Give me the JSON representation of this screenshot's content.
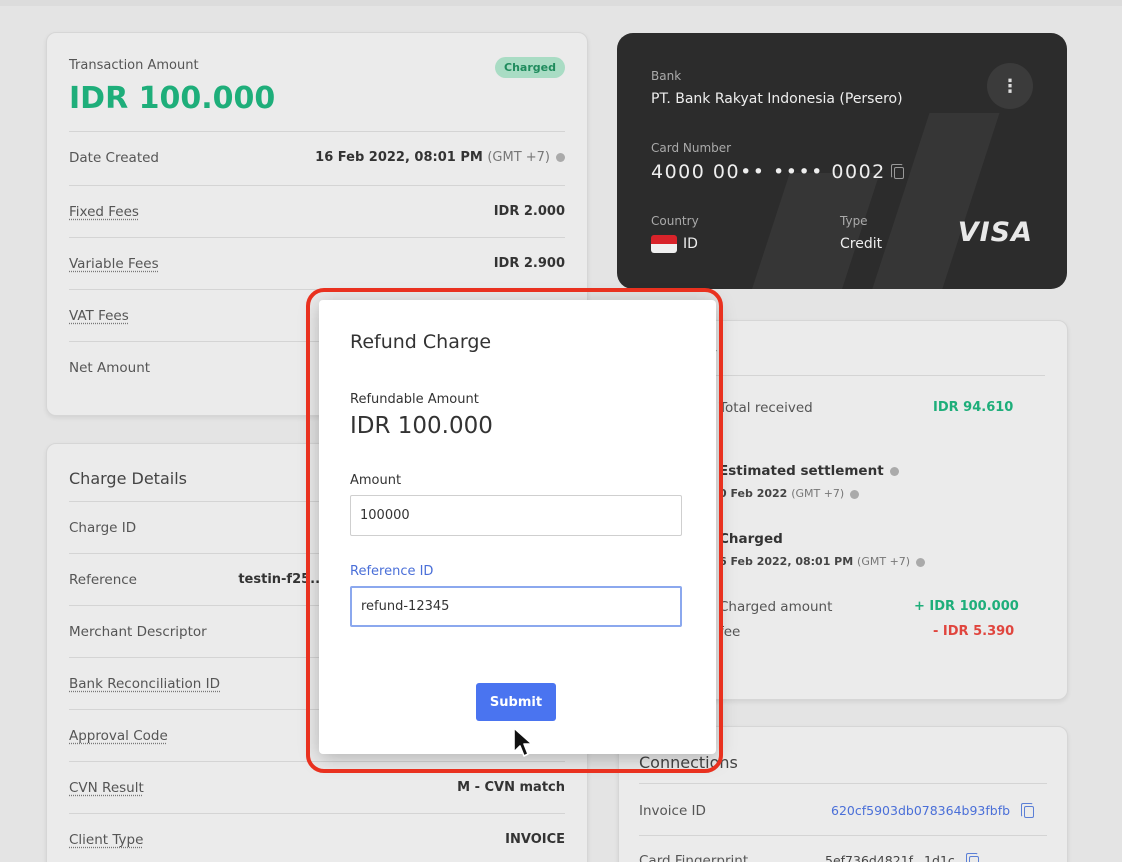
{
  "amount_card": {
    "label": "Transaction Amount",
    "amount": "IDR 100.000",
    "status_badge": "Charged",
    "rows": [
      {
        "label": "Date Created",
        "value": "16 Feb 2022, 08:01 PM",
        "suffix": "(GMT +7)"
      },
      {
        "label": "Fixed Fees",
        "value": "IDR 2.000"
      },
      {
        "label": "Variable Fees",
        "value": "IDR 2.900"
      },
      {
        "label": "VAT Fees",
        "value": ""
      },
      {
        "label": "Net Amount",
        "value": ""
      }
    ]
  },
  "bank_card": {
    "bank_label": "Bank",
    "bank_name": "PT. Bank Rakyat Indonesia (Persero)",
    "card_number_label": "Card Number",
    "card_number": "4000 00•• •••• 0002",
    "country_label": "Country",
    "country": "ID",
    "type_label": "Type",
    "type": "Credit",
    "brand": "VISA",
    "menu_icon": "kebab-icon"
  },
  "charge_details": {
    "title": "Charge Details",
    "rows": [
      {
        "label": "Charge ID",
        "value": ""
      },
      {
        "label": "Reference",
        "value": "testin-f25..."
      },
      {
        "label": "Merchant Descriptor",
        "value": ""
      },
      {
        "label": "Bank Reconciliation ID",
        "value": ""
      },
      {
        "label": "Approval Code",
        "value": ""
      },
      {
        "label": "CVN Result",
        "value": "M - CVN match"
      },
      {
        "label": "Client Type",
        "value": "INVOICE"
      }
    ]
  },
  "summary": {
    "title_fragment": "ry",
    "total_received_label": "Total received",
    "total_received": "IDR 94.610",
    "estimated_settlement_label": "Estimated settlement",
    "estimated_settlement_date": "0 Feb 2022",
    "estimated_settlement_tz": "(GMT +7)",
    "charged_label": "Charged",
    "charged_date": "6 Feb 2022, 08:01 PM",
    "charged_tz": "(GMT +7)",
    "charged_amount_label": "Charged amount",
    "charged_amount": "+ IDR 100.000",
    "fee_label": "fee",
    "fee_amount": "- IDR 5.390"
  },
  "connections": {
    "title": "Connections",
    "invoice_label": "Invoice ID",
    "invoice_id": "620cf5903db078364b93fbfb",
    "card_fp_label": "Card Fingerprint",
    "card_fp": "5ef736d4821f...1d1c"
  },
  "modal": {
    "title": "Refund Charge",
    "refundable_label": "Refundable Amount",
    "refundable_amount": "IDR 100.000",
    "amount_label": "Amount",
    "amount_value": "100000",
    "reference_label": "Reference ID",
    "reference_value": "refund-12345",
    "submit_label": "Submit"
  },
  "colors": {
    "accent_green": "#1eae7a",
    "negative_red": "#e0453e",
    "link_blue": "#4a6fd8",
    "primary_button": "#4a74f0",
    "highlight_red": "#e9311f"
  }
}
